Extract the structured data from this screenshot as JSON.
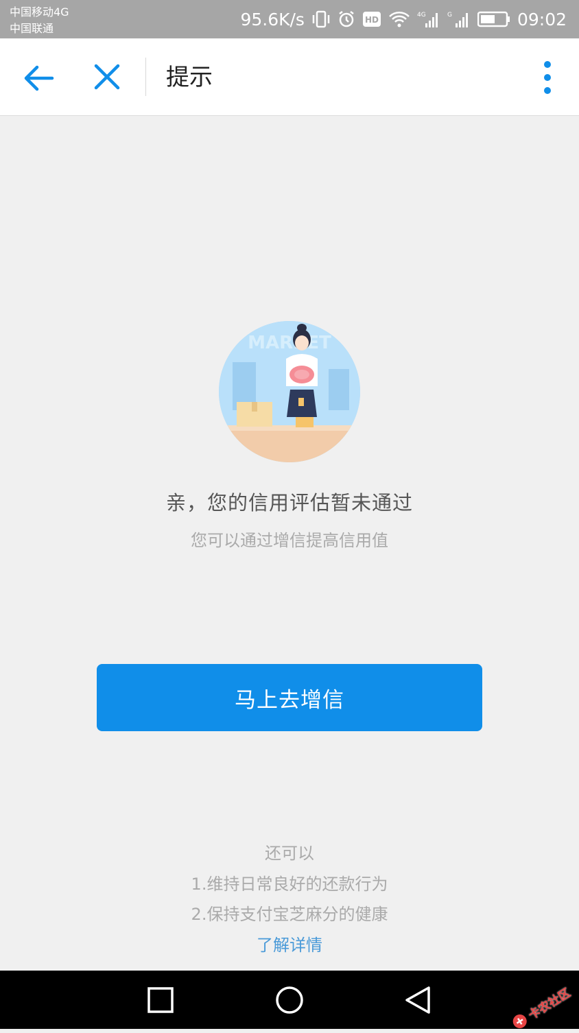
{
  "status_bar": {
    "carrier_1": "中国移动4G",
    "carrier_2": "中国联通",
    "speed": "95.6K/s",
    "time": "09:02",
    "icons": [
      "vibrate-icon",
      "alarm-icon",
      "hd-icon",
      "wifi-icon",
      "signal-4g-icon",
      "signal-g-icon",
      "battery-icon"
    ]
  },
  "app_bar": {
    "title": "提示",
    "back_icon": "arrow-left-icon",
    "close_icon": "close-icon",
    "more_icon": "more-vertical-icon",
    "accent_color": "#108ee9"
  },
  "illustration": {
    "sign_text": "MARKET"
  },
  "main": {
    "headline": "亲，您的信用评估暂未通过",
    "subline": "您可以通过增信提高信用值",
    "primary_button": "马上去增信",
    "button_color": "#108ee9"
  },
  "tips": {
    "heading": "还可以",
    "items": [
      "1.维持日常良好的还款行为",
      "2.保持支付宝芝麻分的健康"
    ],
    "link": "了解详情"
  },
  "nav_bar": {
    "icons": [
      "recent-apps-icon",
      "home-icon",
      "back-triangle-icon"
    ]
  },
  "watermark": {
    "text": "卡农社区"
  }
}
